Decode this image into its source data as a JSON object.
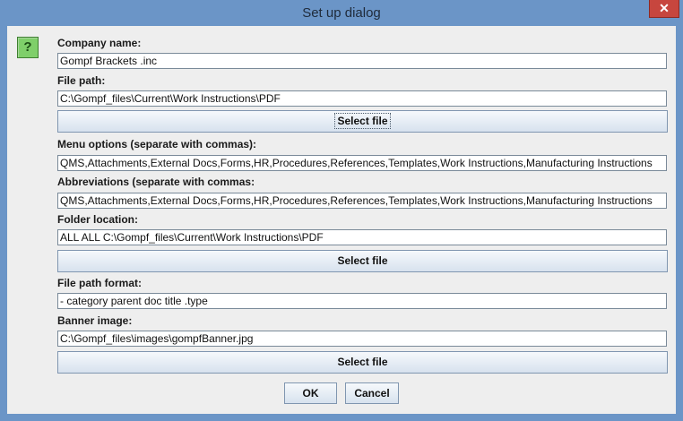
{
  "window": {
    "title": "Set up dialog",
    "close_symbol": "✕",
    "help_icon_symbol": "?"
  },
  "form": {
    "company_name": {
      "label": "Company name:",
      "value": "Gompf Brackets .inc"
    },
    "file_path": {
      "label": "File path:",
      "value": "C:\\Gompf_files\\Current\\Work Instructions\\PDF",
      "button": "Select file"
    },
    "menu_options": {
      "label": "Menu options (separate with commas):",
      "value": "QMS,Attachments,External Docs,Forms,HR,Procedures,References,Templates,Work Instructions,Manufacturing Instructions"
    },
    "abbreviations": {
      "label": "Abbreviations (separate with commas:",
      "value": "QMS,Attachments,External Docs,Forms,HR,Procedures,References,Templates,Work Instructions,Manufacturing Instructions"
    },
    "folder_location": {
      "label": "Folder location:",
      "value": "ALL ALL C:\\Gompf_files\\Current\\Work Instructions\\PDF",
      "button": "Select file"
    },
    "file_path_format": {
      "label": "File path format:",
      "value": "- category parent doc title .type"
    },
    "banner_image": {
      "label": "Banner image:",
      "value": "C:\\Gompf_files\\images\\gompfBanner.jpg",
      "button": "Select file"
    }
  },
  "actions": {
    "ok": "OK",
    "cancel": "Cancel"
  }
}
